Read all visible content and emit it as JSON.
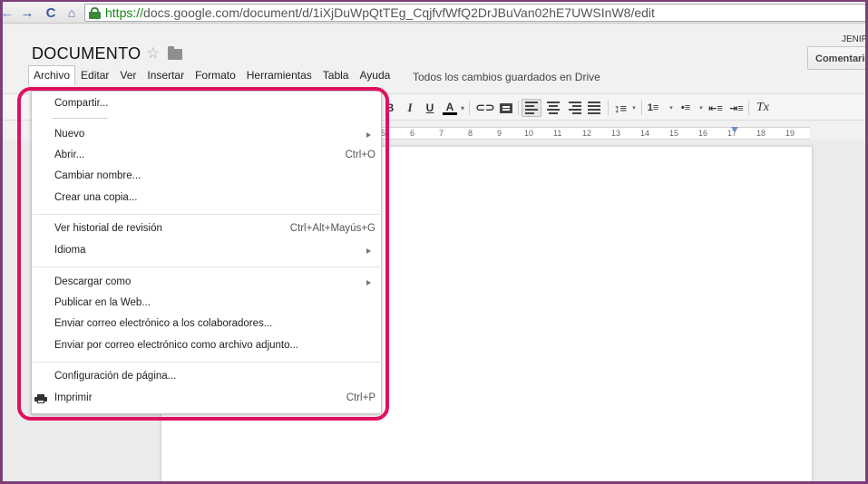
{
  "browser": {
    "url_scheme": "https://",
    "url_rest": "docs.google.com/document/d/1iXjDuWpQtTEg_CqjfvfWfQ2DrJBuVan02hE7UWSInW8/edit",
    "back_icon": "←",
    "forward_icon": "→",
    "reload_icon": "C",
    "home_icon": "⌂"
  },
  "header": {
    "title": "DOCUMENTO",
    "star_icon": "☆",
    "user": "JENIF",
    "comments_button": "Comentarios",
    "save_status": "Todos los cambios guardados en Drive"
  },
  "menubar": {
    "items": [
      "Archivo",
      "Editar",
      "Ver",
      "Insertar",
      "Formato",
      "Herramientas",
      "Tabla",
      "Ayuda"
    ]
  },
  "toolbar": {
    "bold": "B",
    "italic": "I",
    "underline": "U",
    "text_color": "A",
    "caret": "▾",
    "link": "⊂⊃",
    "line_spacing": "↕≡",
    "numbered_list": "1≡",
    "bulleted_list": "•≡",
    "outdent": "⇤≡",
    "indent": "⇥≡",
    "clear_format": "Tx"
  },
  "ruler": {
    "marks": [
      "5",
      "6",
      "7",
      "8",
      "9",
      "10",
      "11",
      "12",
      "13",
      "14",
      "15",
      "16",
      "17",
      "18",
      "19"
    ]
  },
  "file_menu": {
    "share": "Compartir...",
    "new": "Nuevo",
    "open": "Abrir...",
    "open_shortcut": "Ctrl+O",
    "rename": "Cambiar nombre...",
    "make_copy": "Crear una copia...",
    "revision_history": "Ver historial de revisión",
    "revision_shortcut": "Ctrl+Alt+Mayús+G",
    "language": "Idioma",
    "download_as": "Descargar como",
    "publish_web": "Publicar en la Web...",
    "email_collaborators": "Enviar correo electrónico a los colaboradores...",
    "email_attachment": "Enviar por correo electrónico como archivo adjunto...",
    "page_setup": "Configuración de página...",
    "print": "Imprimir",
    "print_shortcut": "Ctrl+P"
  },
  "colors": {
    "highlight": "#e0105f",
    "frame": "#7a3f7a",
    "url_green": "#138a13"
  }
}
